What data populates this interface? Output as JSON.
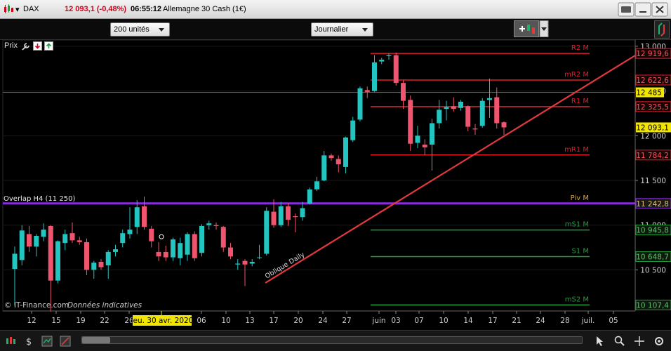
{
  "titlebar": {
    "symbol": "DAX",
    "price_change": "12 093,1 (-0,48%)",
    "time": "06:55:12",
    "instrument": "Allemagne 30 Cash (1€)"
  },
  "toolbar": {
    "units_value": "200 unités",
    "period_value": "Journalier"
  },
  "chart_panel": {
    "prix_label": "Prix",
    "watermark": "© IT-Finance.com",
    "disclaimer": "Données indicatives",
    "overlap_label": "Overlap H4 (11 250)",
    "trend_label": "Oblique Daily",
    "date_tooltip": "jeu. 30 avr. 2020"
  },
  "chart_data": {
    "type": "candlestick",
    "y_range": [
      10040,
      13070
    ],
    "y_ticks": [
      "13 000",
      "12 500",
      "12 000",
      "11 500",
      "11 000",
      "10 500"
    ],
    "y_tick_values": [
      13000,
      12500,
      12000,
      11500,
      11000,
      10500
    ],
    "x_ticks": [
      "12",
      "15",
      "19",
      "22",
      "26",
      "06",
      "10",
      "13",
      "17",
      "20",
      "24",
      "27",
      "juin",
      "03",
      "07",
      "10",
      "14",
      "17",
      "21",
      "24",
      "28",
      "juil.",
      "05"
    ],
    "candles": [
      {
        "o": 10510,
        "h": 10760,
        "l": 10100,
        "c": 10680
      },
      {
        "o": 10610,
        "h": 11000,
        "l": 10550,
        "c": 10940
      },
      {
        "o": 10900,
        "h": 10990,
        "l": 10700,
        "c": 10760
      },
      {
        "o": 10760,
        "h": 10900,
        "l": 10650,
        "c": 10880
      },
      {
        "o": 10870,
        "h": 11020,
        "l": 10820,
        "c": 10950
      },
      {
        "o": 10990,
        "h": 11000,
        "l": 10030,
        "c": 10380
      },
      {
        "o": 10380,
        "h": 10830,
        "l": 10350,
        "c": 10820
      },
      {
        "o": 10800,
        "h": 10950,
        "l": 10720,
        "c": 10900
      },
      {
        "o": 10910,
        "h": 11030,
        "l": 10800,
        "c": 10830
      },
      {
        "o": 10830,
        "h": 10870,
        "l": 10780,
        "c": 10810
      },
      {
        "o": 10810,
        "h": 10850,
        "l": 10440,
        "c": 10500
      },
      {
        "o": 10500,
        "h": 10600,
        "l": 10400,
        "c": 10580
      },
      {
        "o": 10590,
        "h": 10620,
        "l": 10500,
        "c": 10530
      },
      {
        "o": 10550,
        "h": 10720,
        "l": 10400,
        "c": 10700
      },
      {
        "o": 10700,
        "h": 10780,
        "l": 10650,
        "c": 10730
      },
      {
        "o": 10800,
        "h": 10950,
        "l": 10750,
        "c": 10910
      },
      {
        "o": 10900,
        "h": 11200,
        "l": 10850,
        "c": 10950
      },
      {
        "o": 10980,
        "h": 11280,
        "l": 10900,
        "c": 11200
      },
      {
        "o": 11210,
        "h": 11320,
        "l": 10950,
        "c": 10980
      },
      {
        "o": 10960,
        "h": 10990,
        "l": 10750,
        "c": 10820
      },
      {
        "o": 10700,
        "h": 10810,
        "l": 10600,
        "c": 10650
      },
      {
        "o": 10700,
        "h": 10770,
        "l": 10600,
        "c": 10640
      },
      {
        "o": 10640,
        "h": 10860,
        "l": 10600,
        "c": 10840
      },
      {
        "o": 10630,
        "h": 10860,
        "l": 10550,
        "c": 10800
      },
      {
        "o": 10670,
        "h": 10920,
        "l": 10600,
        "c": 10900
      },
      {
        "o": 10900,
        "h": 10930,
        "l": 10600,
        "c": 10630
      },
      {
        "o": 10690,
        "h": 11010,
        "l": 10650,
        "c": 10990
      },
      {
        "o": 11000,
        "h": 11050,
        "l": 10950,
        "c": 11020
      },
      {
        "o": 11000,
        "h": 11030,
        "l": 10950,
        "c": 10990
      },
      {
        "o": 10980,
        "h": 10990,
        "l": 10700,
        "c": 10750
      },
      {
        "o": 10750,
        "h": 10800,
        "l": 10620,
        "c": 10650
      },
      {
        "o": 10560,
        "h": 10620,
        "l": 10500,
        "c": 10570
      },
      {
        "o": 10600,
        "h": 10620,
        "l": 10320,
        "c": 10560
      },
      {
        "o": 10570,
        "h": 10620,
        "l": 10540,
        "c": 10590
      },
      {
        "o": 10640,
        "h": 10780,
        "l": 10620,
        "c": 10640
      },
      {
        "o": 10680,
        "h": 11200,
        "l": 10660,
        "c": 11160
      },
      {
        "o": 11150,
        "h": 11290,
        "l": 10970,
        "c": 11000
      },
      {
        "o": 11000,
        "h": 11260,
        "l": 10980,
        "c": 11210
      },
      {
        "o": 11210,
        "h": 11250,
        "l": 10990,
        "c": 11060
      },
      {
        "o": 11100,
        "h": 11130,
        "l": 10920,
        "c": 11090
      },
      {
        "o": 11090,
        "h": 11260,
        "l": 11050,
        "c": 11190
      },
      {
        "o": 11240,
        "h": 11420,
        "l": 11230,
        "c": 11400
      },
      {
        "o": 11400,
        "h": 11540,
        "l": 11380,
        "c": 11490
      },
      {
        "o": 11500,
        "h": 11830,
        "l": 11490,
        "c": 11780
      },
      {
        "o": 11780,
        "h": 11800,
        "l": 11720,
        "c": 11750
      },
      {
        "o": 11740,
        "h": 11780,
        "l": 11590,
        "c": 11680
      },
      {
        "o": 11650,
        "h": 11990,
        "l": 11580,
        "c": 11980
      },
      {
        "o": 11950,
        "h": 12210,
        "l": 11930,
        "c": 12170
      },
      {
        "o": 12180,
        "h": 12550,
        "l": 12160,
        "c": 12530
      },
      {
        "o": 12510,
        "h": 12550,
        "l": 12420,
        "c": 12490
      },
      {
        "o": 12500,
        "h": 12900,
        "l": 12490,
        "c": 12820
      },
      {
        "o": 12830,
        "h": 12870,
        "l": 12800,
        "c": 12850
      },
      {
        "o": 12890,
        "h": 12920,
        "l": 12850,
        "c": 12900
      },
      {
        "o": 12900,
        "h": 12930,
        "l": 12560,
        "c": 12590
      },
      {
        "o": 12590,
        "h": 12620,
        "l": 12300,
        "c": 12390
      },
      {
        "o": 12400,
        "h": 12450,
        "l": 11830,
        "c": 11910
      },
      {
        "o": 11920,
        "h": 12110,
        "l": 11860,
        "c": 12000
      },
      {
        "o": 11900,
        "h": 11960,
        "l": 11780,
        "c": 11870
      },
      {
        "o": 11900,
        "h": 12190,
        "l": 11610,
        "c": 12140
      },
      {
        "o": 12140,
        "h": 12400,
        "l": 12080,
        "c": 12290
      },
      {
        "o": 12300,
        "h": 12390,
        "l": 12170,
        "c": 12320
      },
      {
        "o": 12330,
        "h": 12430,
        "l": 12270,
        "c": 12300
      },
      {
        "o": 12310,
        "h": 12400,
        "l": 12280,
        "c": 12380
      },
      {
        "o": 12330,
        "h": 12340,
        "l": 12050,
        "c": 12100
      },
      {
        "o": 12080,
        "h": 12130,
        "l": 12010,
        "c": 12070
      },
      {
        "o": 12110,
        "h": 12420,
        "l": 12090,
        "c": 12390
      },
      {
        "o": 12400,
        "h": 12640,
        "l": 12200,
        "c": 12420
      },
      {
        "o": 12430,
        "h": 12540,
        "l": 12080,
        "c": 12140
      },
      {
        "o": 12150,
        "h": 12160,
        "l": 12010,
        "c": 12093
      }
    ],
    "levels": [
      {
        "name": "R2 M",
        "value": 12919.6,
        "label": "12 919,6",
        "color": "#e11d2a",
        "style": "solid"
      },
      {
        "name": "mR2 M",
        "value": 12622.6,
        "label": "12 622,6",
        "color": "#e11d2a",
        "style": "solid"
      },
      {
        "name": "R1 M",
        "value": 12325.5,
        "label": "12 325,5",
        "color": "#e11d2a",
        "style": "solid"
      },
      {
        "name": "mR1 M",
        "value": 11784.2,
        "label": "11 784,2",
        "color": "#e11d2a",
        "style": "solid"
      },
      {
        "name": "Piv M",
        "value": 11242.8,
        "label": "11 242,8",
        "color": "#c08a2a",
        "style": "solid"
      },
      {
        "name": "mS1 M",
        "value": 10945.8,
        "label": "10 945,8",
        "color": "#1e9e3a",
        "style": "solid"
      },
      {
        "name": "S1 M",
        "value": 10648.7,
        "label": "10 648,7",
        "color": "#1e9e3a",
        "style": "solid"
      },
      {
        "name": "mS2 M",
        "value": 10107.4,
        "label": "10 107,4",
        "color": "#1e9e3a",
        "style": "solid"
      }
    ],
    "current_price": {
      "value": 12093.1,
      "label": "12 093,1"
    },
    "marker_price": {
      "value": 12485,
      "label": "12 485"
    },
    "overlap_value": 11250,
    "colors": {
      "up": "#22c5c0",
      "down": "#f0546e",
      "background": "#000000",
      "purple": "#8a2be2",
      "trend": "#e0393e"
    }
  }
}
